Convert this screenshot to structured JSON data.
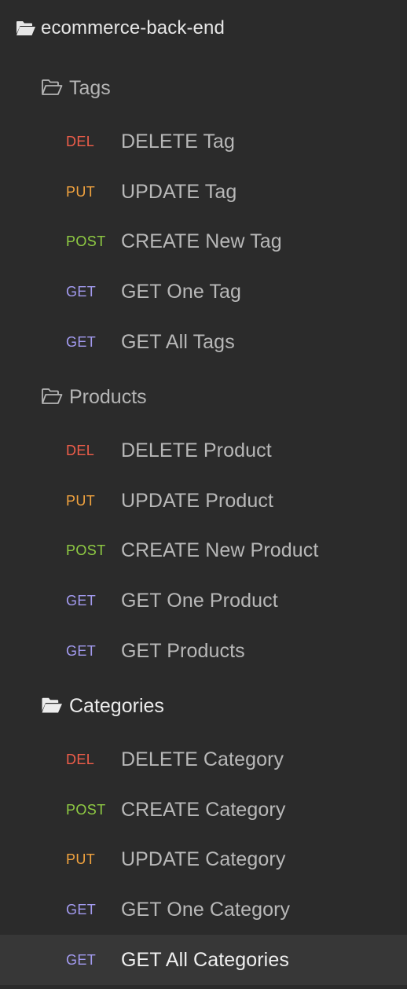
{
  "root": {
    "label": "ecommerce-back-end",
    "icon": "folder-open-icon"
  },
  "folders": [
    {
      "label": "Tags",
      "icon": "folder-open-outline-icon",
      "requests": [
        {
          "method": "DEL",
          "label": "DELETE Tag"
        },
        {
          "method": "PUT",
          "label": "UPDATE Tag"
        },
        {
          "method": "POST",
          "label": "CREATE New Tag"
        },
        {
          "method": "GET",
          "label": "GET One Tag"
        },
        {
          "method": "GET",
          "label": "GET All Tags"
        }
      ]
    },
    {
      "label": "Products",
      "icon": "folder-open-outline-icon",
      "requests": [
        {
          "method": "DEL",
          "label": "DELETE Product"
        },
        {
          "method": "PUT",
          "label": "UPDATE Product"
        },
        {
          "method": "POST",
          "label": "CREATE New Product"
        },
        {
          "method": "GET",
          "label": "GET One Product"
        },
        {
          "method": "GET",
          "label": "GET Products"
        }
      ]
    },
    {
      "label": "Categories",
      "icon": "folder-open-filled-icon",
      "requests": [
        {
          "method": "DEL",
          "label": "DELETE Category"
        },
        {
          "method": "POST",
          "label": "CREATE Category"
        },
        {
          "method": "PUT",
          "label": "UPDATE Category"
        },
        {
          "method": "GET",
          "label": "GET One Category"
        },
        {
          "method": "GET",
          "label": "GET All Categories"
        }
      ]
    }
  ],
  "colors": {
    "background": "#2b2b2b",
    "active_row": "#373737",
    "DEL": "#ef5d4a",
    "PUT": "#f2a33f",
    "POST": "#8fcb43",
    "GET": "#a39bf0"
  }
}
